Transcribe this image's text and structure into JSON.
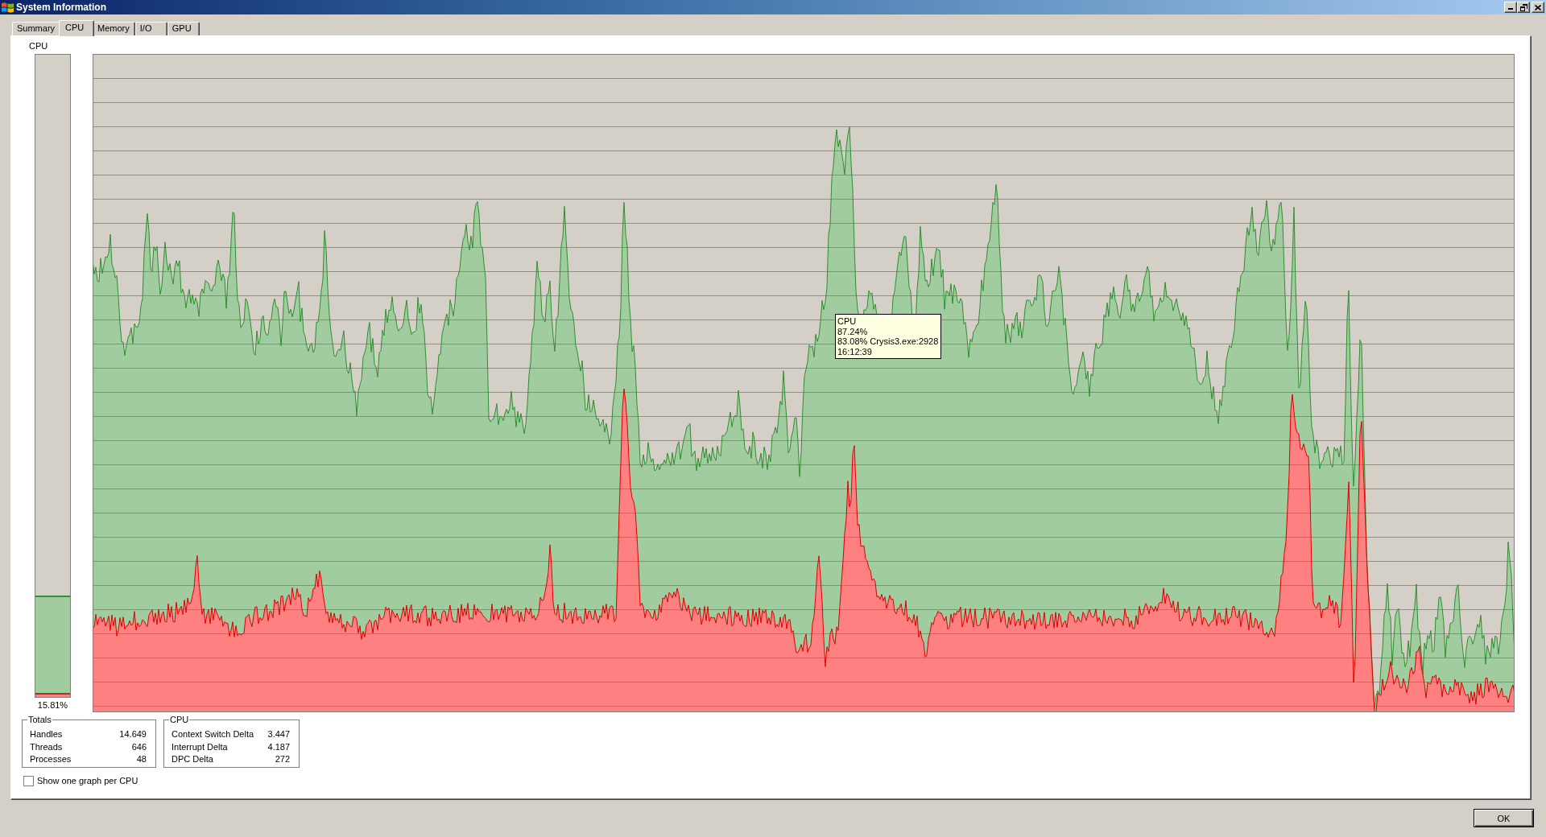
{
  "window": {
    "title": "System Information"
  },
  "tabs": [
    {
      "label": "Summary",
      "selected": false
    },
    {
      "label": "CPU",
      "selected": true
    },
    {
      "label": "Memory",
      "selected": false
    },
    {
      "label": "I/O",
      "selected": false
    },
    {
      "label": "GPU",
      "selected": false
    }
  ],
  "cpu_meter": {
    "label": "CPU",
    "reading": "15.81%",
    "fills": [
      {
        "level": 0.1581,
        "color": "#a0cca0"
      },
      {
        "level": 0.006,
        "color": "#ff8080"
      }
    ]
  },
  "graph": {
    "tooltip": [
      "CPU",
      "87.24%",
      "83.08% Crysis3.exe:2928",
      "16:12:39"
    ]
  },
  "groups": [
    {
      "title": "Totals",
      "rows": [
        {
          "label": "Handles",
          "value": "14.649"
        },
        {
          "label": "Threads",
          "value": "646"
        },
        {
          "label": "Processes",
          "value": "48"
        }
      ]
    },
    {
      "title": "CPU",
      "rows": [
        {
          "label": "Context Switch Delta",
          "value": "3.447"
        },
        {
          "label": "Interrupt Delta",
          "value": "4.187"
        },
        {
          "label": "DPC Delta",
          "value": "272"
        }
      ]
    }
  ],
  "checkbox": {
    "label": "Show one graph per CPU",
    "checked": false
  },
  "buttons": [
    "OK"
  ]
}
